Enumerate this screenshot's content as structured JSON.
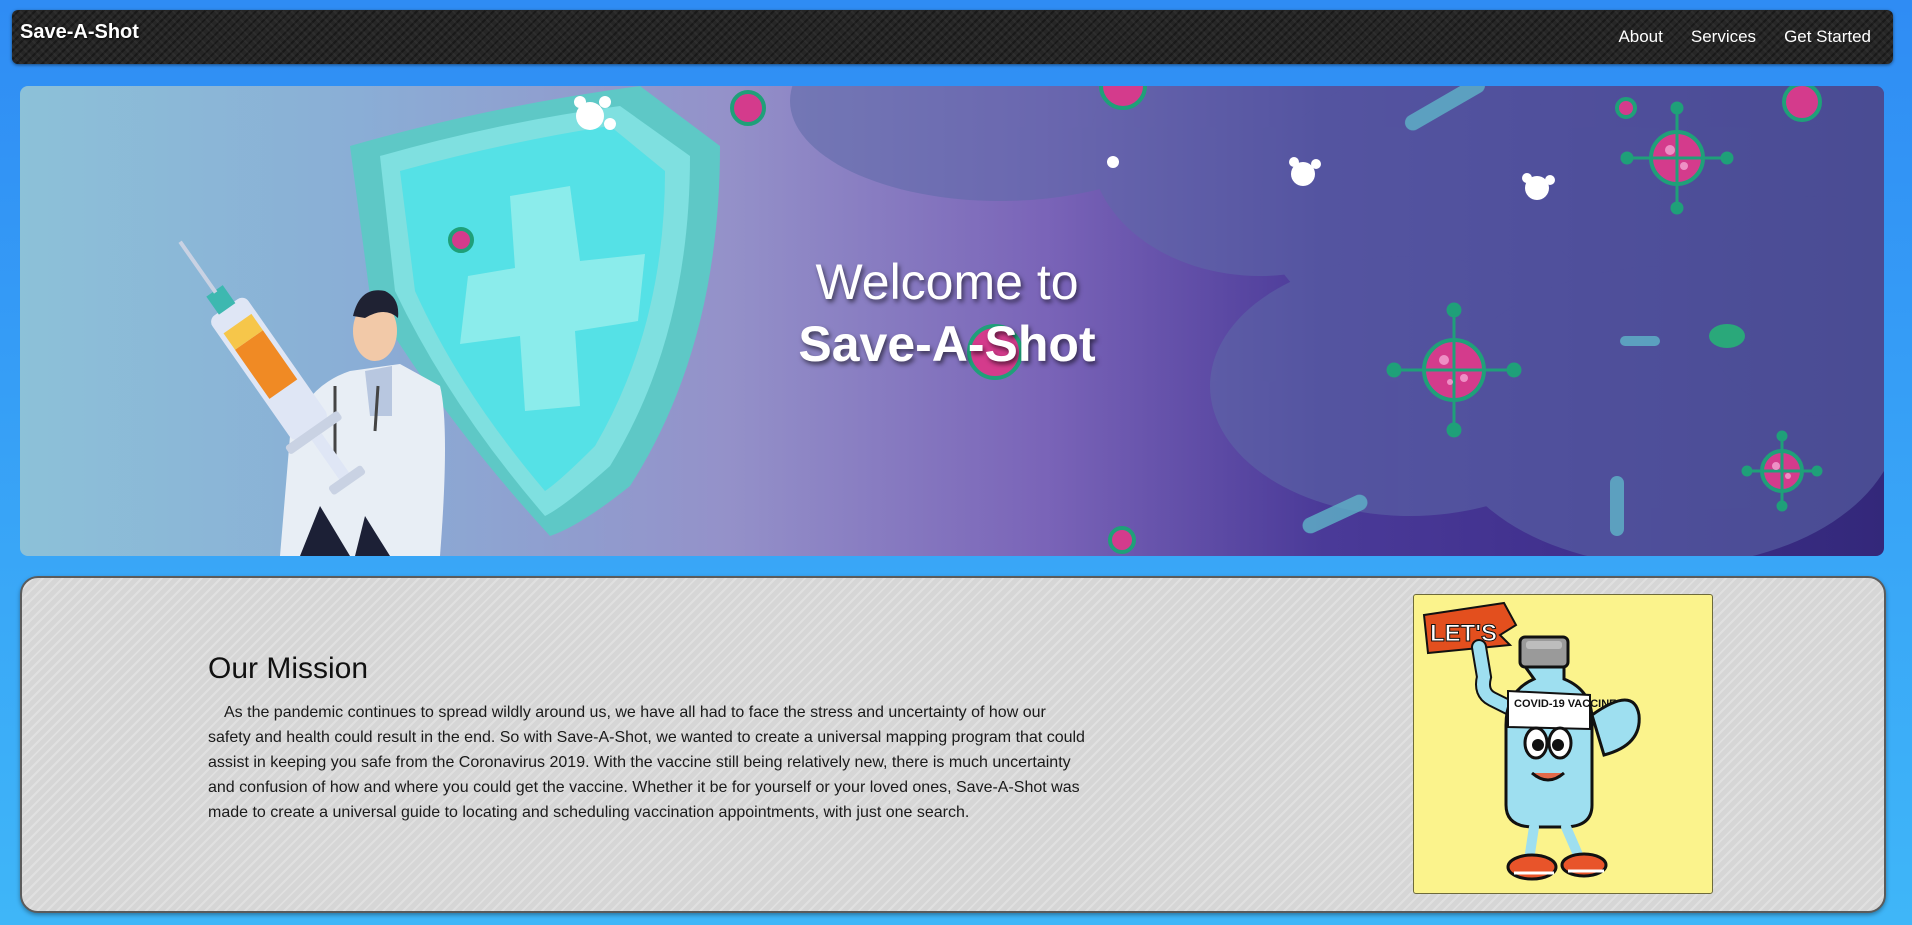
{
  "navbar": {
    "brand": "Save-A-Shot",
    "links": [
      "About",
      "Services",
      "Get Started"
    ]
  },
  "hero": {
    "line1": "Welcome to",
    "line2": "Save-A-Shot"
  },
  "mission": {
    "title": "Our Mission",
    "body": "As the pandemic continues to spread wildly around us, we have all had to face the stress and uncertainty of how our safety and health could result in the end. So with Save-A-Shot, we wanted to create a universal mapping program that could assist in keeping you safe from the Coronavirus 2019. With the vaccine still being relatively new, there is much uncertainty and confusion of how and where you could get the vaccine. Whether it be for yourself or your loved ones, Save-A-Shot was made to create a universal guide to locating and scheduling vaccination appointments, with just one search."
  },
  "illustration": {
    "sign_text": "LET'S",
    "bottle_label": "COVID-19 VACCINE"
  },
  "colors": {
    "page_bg": "#2f8cf4",
    "navbar_bg": "#262626",
    "card_bg": "#d6d6d6",
    "illustration_bg": "#fbf38c"
  }
}
